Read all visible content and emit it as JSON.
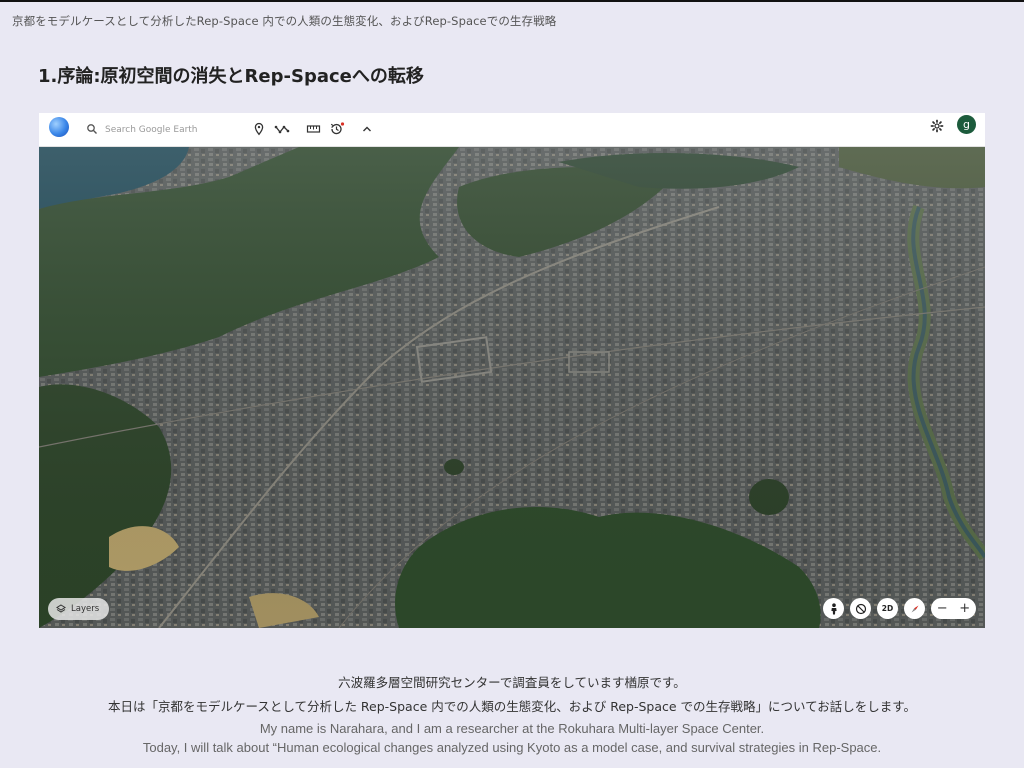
{
  "document": {
    "title": "京都をモデルケースとして分析したRep-Space 内での人類の生態変化、およびRep-Spaceでの生存戦略",
    "section_heading": "1.序論:原初空間の消失とRep-Spaceへの転移"
  },
  "earth_app": {
    "search_placeholder": "Search Google Earth",
    "toolbar_icons": [
      "pin-icon",
      "path-icon",
      "ruler-icon",
      "history-icon",
      "chevron-up-icon"
    ],
    "settings_icon": "gear-icon",
    "avatar_letter": "g",
    "layers_label": "Layers",
    "view_mode_label": "2D",
    "zoom_out_label": "−",
    "zoom_in_label": "+",
    "colors": {
      "avatar_bg": "#1c5b3c",
      "toolbar_bg": "#ffffff",
      "notification_dot": "#d93025"
    }
  },
  "captions": {
    "jp_line1": "六波羅多層空間研究センターで調査員をしています楢原です。",
    "jp_line2": "本日は「京都をモデルケースとして分析した Rep-Space 内での人類の生態変化、および Rep-Space での生存戦略」についてお話しをします。",
    "en_line1": "My name is Narahara, and I am a researcher at the Rokuhara Multi-layer Space Center.",
    "en_line2": "Today, I will talk about “Human ecological changes analyzed using Kyoto as a model case, and survival strategies in Rep-Space."
  }
}
